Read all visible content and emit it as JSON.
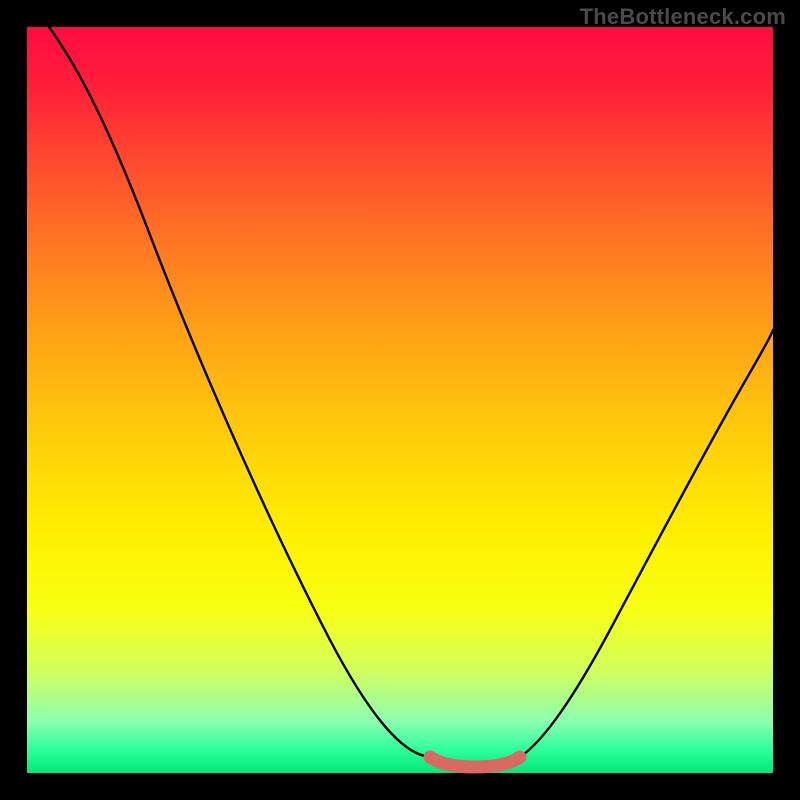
{
  "watermark": "TheBottleneck.com",
  "chart_data": {
    "type": "line",
    "title": "",
    "xlabel": "",
    "ylabel": "",
    "xlim": [
      0,
      100
    ],
    "ylim": [
      0,
      100
    ],
    "series": [
      {
        "name": "curve-left",
        "x": [
          3,
          10,
          20,
          30,
          40,
          50,
          55
        ],
        "y": [
          100,
          87,
          70,
          51,
          32,
          12,
          3
        ]
      },
      {
        "name": "curve-right",
        "x": [
          66,
          70,
          75,
          80,
          85,
          90,
          95,
          100
        ],
        "y": [
          3,
          10,
          19,
          28,
          37,
          45,
          53,
          60
        ]
      },
      {
        "name": "flat-band",
        "x": [
          55,
          58,
          60,
          62,
          64,
          66
        ],
        "y": [
          3,
          1.5,
          1,
          1,
          1.5,
          3
        ]
      }
    ],
    "colors": {
      "curve": "#000000",
      "band": "#d96a63",
      "gradient": [
        "#ff0b41",
        "#ffce0a",
        "#00e878"
      ]
    }
  }
}
